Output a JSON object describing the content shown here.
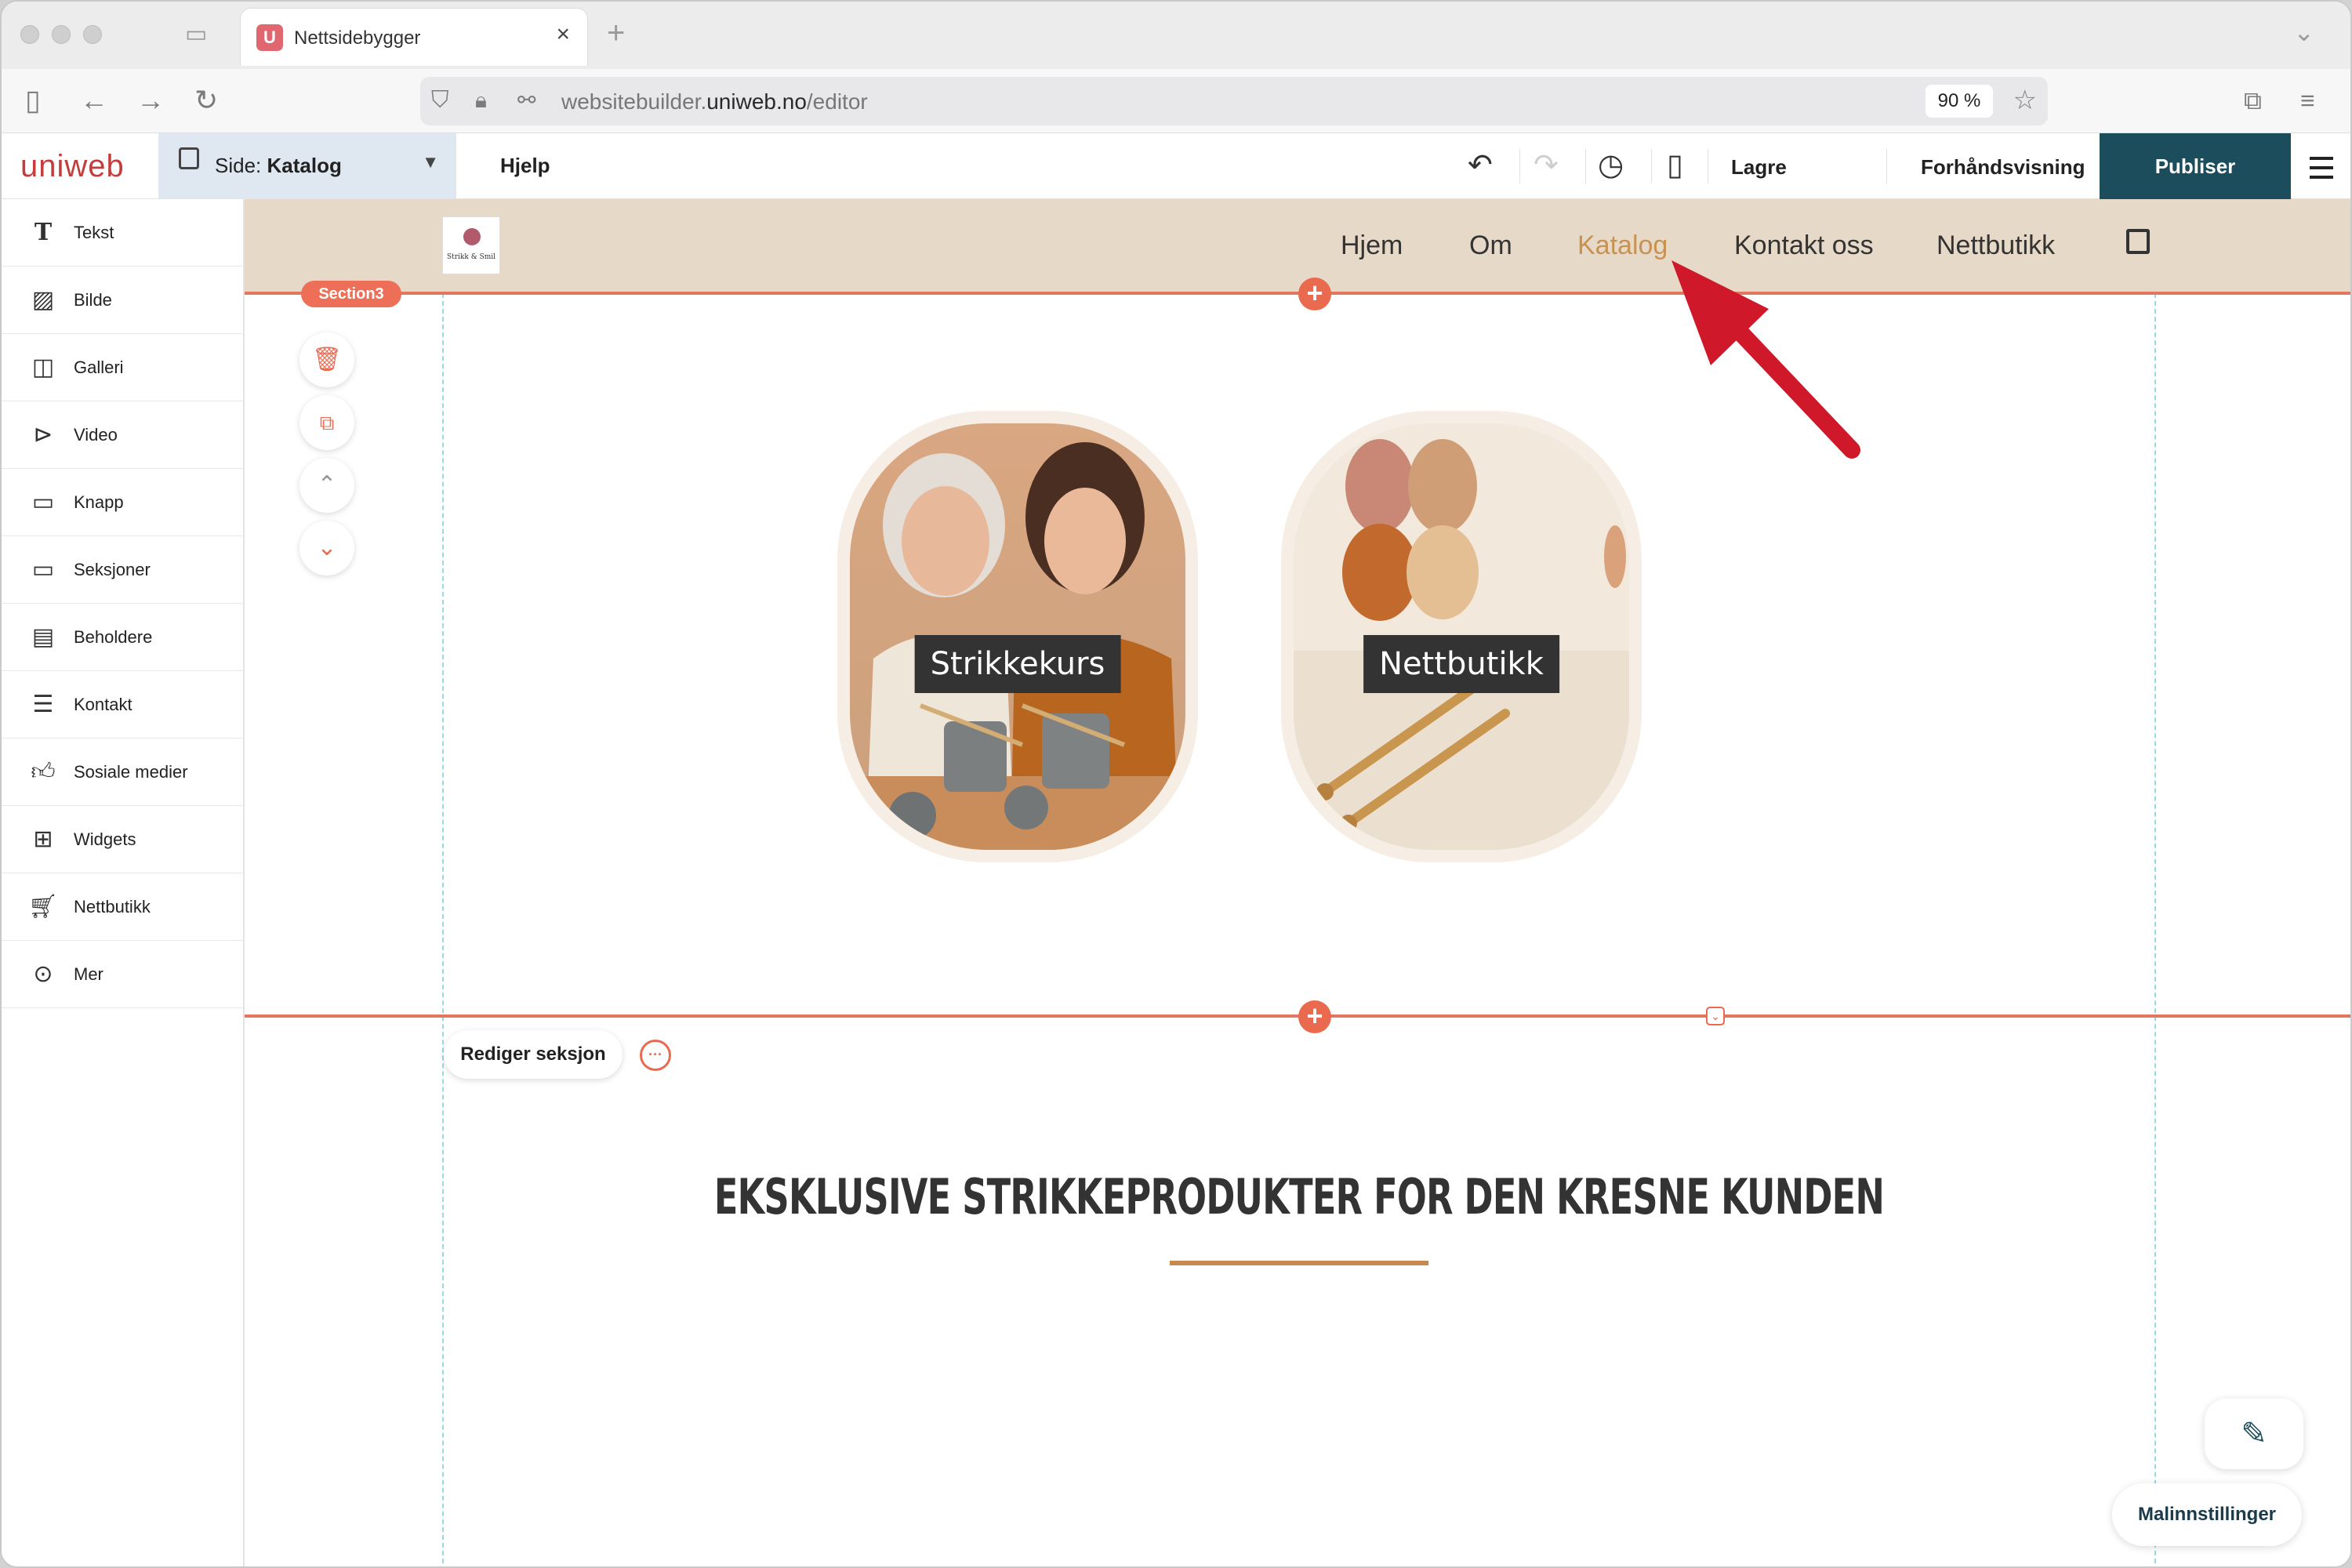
{
  "browser": {
    "tab_title": "Nettsidebygger",
    "tab_favicon": "U",
    "url_host": "websitebuilder.",
    "url_domain": "uniweb.no",
    "url_path": "/editor",
    "zoom": "90 %"
  },
  "editor": {
    "logo": "uniweb",
    "page_prefix": "Side:",
    "page_name": "Katalog",
    "help": "Hjelp",
    "save": "Lagre",
    "preview": "Forhåndsvisning",
    "publish": "Publiser"
  },
  "sidebar": {
    "items": [
      {
        "label": "Tekst",
        "icon": "text-icon"
      },
      {
        "label": "Bilde",
        "icon": "image-icon"
      },
      {
        "label": "Galleri",
        "icon": "gallery-icon"
      },
      {
        "label": "Video",
        "icon": "video-icon"
      },
      {
        "label": "Knapp",
        "icon": "button-icon"
      },
      {
        "label": "Seksjoner",
        "icon": "sections-icon"
      },
      {
        "label": "Beholdere",
        "icon": "containers-icon"
      },
      {
        "label": "Kontakt",
        "icon": "contact-icon"
      },
      {
        "label": "Sosiale medier",
        "icon": "thumbs-up-icon"
      },
      {
        "label": "Widgets",
        "icon": "widgets-icon"
      },
      {
        "label": "Nettbutikk",
        "icon": "cart-icon"
      },
      {
        "label": "Mer",
        "icon": "more-icon"
      }
    ]
  },
  "site": {
    "logo_text": "Strikk & Smil",
    "nav": [
      "Hjem",
      "Om",
      "Katalog",
      "Kontakt oss",
      "Nettbutikk"
    ],
    "active_nav": "Katalog",
    "section_badge": "Section3",
    "cards": [
      {
        "label": "Strikkekurs"
      },
      {
        "label": "Nettbutikk"
      }
    ],
    "edit_section": "Rediger seksjon",
    "headline": "EKSKLUSIVE STRIKKEPRODUKTER FOR DEN KRESNE KUNDEN",
    "template_settings": "Malinnstillinger"
  },
  "colors": {
    "publish": "#1b4d5c",
    "accent": "#e96a4f",
    "header_bg": "#e7d9c8",
    "active_nav": "#c79252",
    "arrow": "#d0182b"
  }
}
